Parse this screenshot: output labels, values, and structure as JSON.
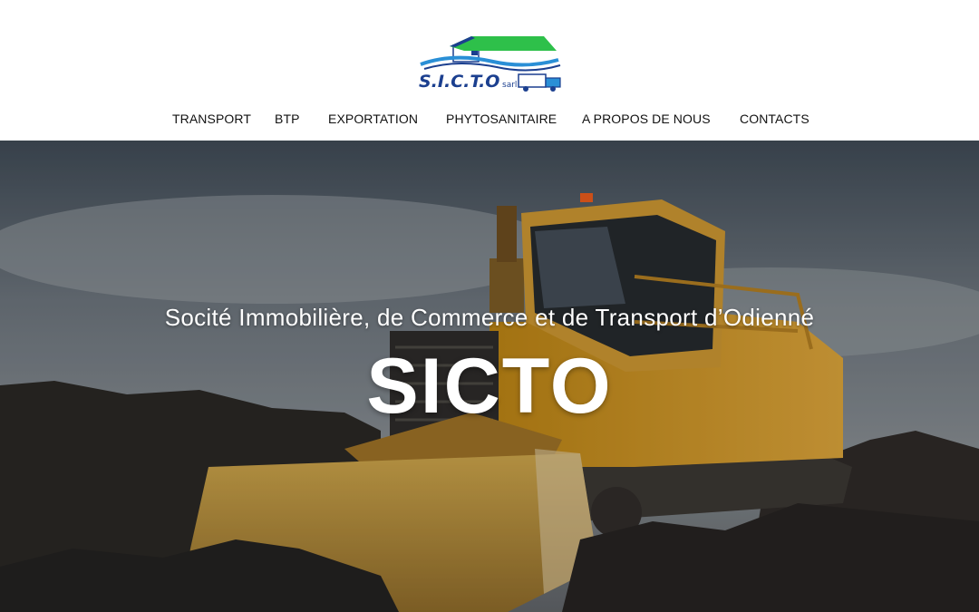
{
  "logo": {
    "brand": "S.I.C.T.O",
    "suffix": "sarl",
    "colors": {
      "roof": "#2ec04a",
      "brand": "#1b3f8f",
      "wave": "#2a8fd6"
    }
  },
  "nav": {
    "items": [
      {
        "label": "TRANSPORT"
      },
      {
        "label": "BTP"
      },
      {
        "label": "EXPORTATION"
      },
      {
        "label": "PHYTOSANITAIRE"
      },
      {
        "label": "A PROPOS DE NOUS"
      },
      {
        "label": "CONTACTS"
      }
    ]
  },
  "hero": {
    "subtitle": "Socité Immobilière, de Commerce et  de Transport d’Odienné",
    "title": "SICTO",
    "image": "bulldozer-on-soil",
    "colors": {
      "sky": "#55606b",
      "machine": "#d49a1e",
      "soil": "#2b2825"
    }
  }
}
